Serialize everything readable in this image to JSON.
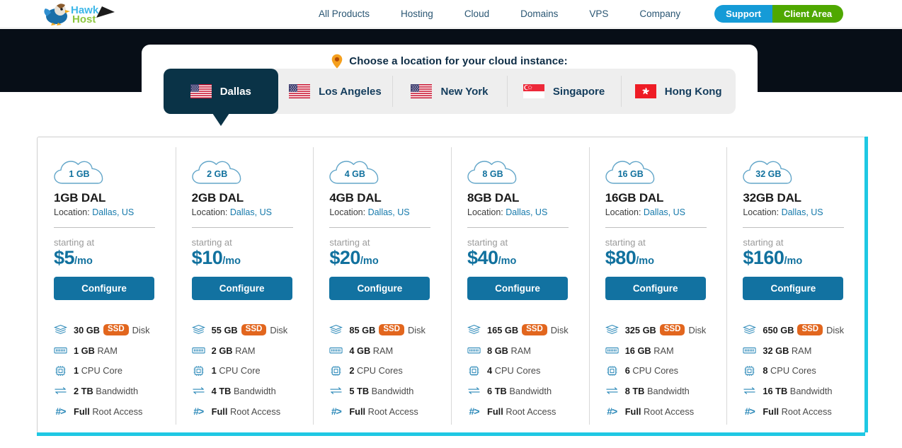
{
  "brand": {
    "name": "Hawk Host",
    "logo_icon": "hawk-logo"
  },
  "nav": {
    "links": [
      {
        "label": "All Products"
      },
      {
        "label": "Hosting"
      },
      {
        "label": "Cloud"
      },
      {
        "label": "Domains"
      },
      {
        "label": "VPS"
      },
      {
        "label": "Company"
      }
    ],
    "support_label": "Support",
    "client_area_label": "Client Area",
    "support_color": "#159bd7",
    "client_area_color": "#4fa800"
  },
  "location_picker": {
    "heading": "Choose a location for your cloud instance:",
    "pin_icon": "map-pin-icon",
    "pin_color": "#f5a01e",
    "active_color": "#0a3347",
    "tabs": [
      {
        "label": "Dallas",
        "flag": "us-flag-icon",
        "active": true
      },
      {
        "label": "Los Angeles",
        "flag": "us-flag-icon",
        "active": false
      },
      {
        "label": "New York",
        "flag": "us-flag-icon",
        "active": false
      },
      {
        "label": "Singapore",
        "flag": "sg-flag-icon",
        "active": false
      },
      {
        "label": "Hong Kong",
        "flag": "hk-flag-icon",
        "active": false
      }
    ]
  },
  "plans_common": {
    "location_prefix": "Location:",
    "location_link": "Dallas, US",
    "starting_at": "starting at",
    "configure_label": "Configure",
    "per_month": "/mo",
    "ssd_badge": "SSD",
    "accent_color": "#1272a1",
    "ssd_color": "#e2661e",
    "edge_color": "#1fc8e3"
  },
  "plans": [
    {
      "cloud_label": "1 GB",
      "title": "1GB DAL",
      "price": "$5",
      "features": [
        {
          "icon": "disk-icon",
          "value": "30 GB",
          "pill": "SSD",
          "label": "Disk"
        },
        {
          "icon": "ram-icon",
          "value": "1 GB",
          "pill": "",
          "label": "RAM"
        },
        {
          "icon": "cpu-icon",
          "value": "1",
          "pill": "",
          "label": "CPU Core"
        },
        {
          "icon": "bandwidth-icon",
          "value": "2 TB",
          "pill": "",
          "label": "Bandwidth"
        },
        {
          "icon": "root-icon",
          "value": "Full",
          "pill": "",
          "label": "Root Access"
        }
      ]
    },
    {
      "cloud_label": "2 GB",
      "title": "2GB DAL",
      "price": "$10",
      "features": [
        {
          "icon": "disk-icon",
          "value": "55 GB",
          "pill": "SSD",
          "label": "Disk"
        },
        {
          "icon": "ram-icon",
          "value": "2 GB",
          "pill": "",
          "label": "RAM"
        },
        {
          "icon": "cpu-icon",
          "value": "1",
          "pill": "",
          "label": "CPU Core"
        },
        {
          "icon": "bandwidth-icon",
          "value": "4 TB",
          "pill": "",
          "label": "Bandwidth"
        },
        {
          "icon": "root-icon",
          "value": "Full",
          "pill": "",
          "label": "Root Access"
        }
      ]
    },
    {
      "cloud_label": "4 GB",
      "title": "4GB DAL",
      "price": "$20",
      "features": [
        {
          "icon": "disk-icon",
          "value": "85 GB",
          "pill": "SSD",
          "label": "Disk"
        },
        {
          "icon": "ram-icon",
          "value": "4 GB",
          "pill": "",
          "label": "RAM"
        },
        {
          "icon": "cpu-icon",
          "value": "2",
          "pill": "",
          "label": "CPU Cores"
        },
        {
          "icon": "bandwidth-icon",
          "value": "5 TB",
          "pill": "",
          "label": "Bandwidth"
        },
        {
          "icon": "root-icon",
          "value": "Full",
          "pill": "",
          "label": "Root Access"
        }
      ]
    },
    {
      "cloud_label": "8 GB",
      "title": "8GB DAL",
      "price": "$40",
      "features": [
        {
          "icon": "disk-icon",
          "value": "165 GB",
          "pill": "SSD",
          "label": "Disk"
        },
        {
          "icon": "ram-icon",
          "value": "8 GB",
          "pill": "",
          "label": "RAM"
        },
        {
          "icon": "cpu-icon",
          "value": "4",
          "pill": "",
          "label": "CPU Cores"
        },
        {
          "icon": "bandwidth-icon",
          "value": "6 TB",
          "pill": "",
          "label": "Bandwidth"
        },
        {
          "icon": "root-icon",
          "value": "Full",
          "pill": "",
          "label": "Root Access"
        }
      ]
    },
    {
      "cloud_label": "16 GB",
      "title": "16GB DAL",
      "price": "$80",
      "features": [
        {
          "icon": "disk-icon",
          "value": "325 GB",
          "pill": "SSD",
          "label": "Disk"
        },
        {
          "icon": "ram-icon",
          "value": "16 GB",
          "pill": "",
          "label": "RAM"
        },
        {
          "icon": "cpu-icon",
          "value": "6",
          "pill": "",
          "label": "CPU Cores"
        },
        {
          "icon": "bandwidth-icon",
          "value": "8 TB",
          "pill": "",
          "label": "Bandwidth"
        },
        {
          "icon": "root-icon",
          "value": "Full",
          "pill": "",
          "label": "Root Access"
        }
      ]
    },
    {
      "cloud_label": "32 GB",
      "title": "32GB DAL",
      "price": "$160",
      "features": [
        {
          "icon": "disk-icon",
          "value": "650 GB",
          "pill": "SSD",
          "label": "Disk"
        },
        {
          "icon": "ram-icon",
          "value": "32 GB",
          "pill": "",
          "label": "RAM"
        },
        {
          "icon": "cpu-icon",
          "value": "8",
          "pill": "",
          "label": "CPU Cores"
        },
        {
          "icon": "bandwidth-icon",
          "value": "16 TB",
          "pill": "",
          "label": "Bandwidth"
        },
        {
          "icon": "root-icon",
          "value": "Full",
          "pill": "",
          "label": "Root Access"
        }
      ]
    }
  ]
}
